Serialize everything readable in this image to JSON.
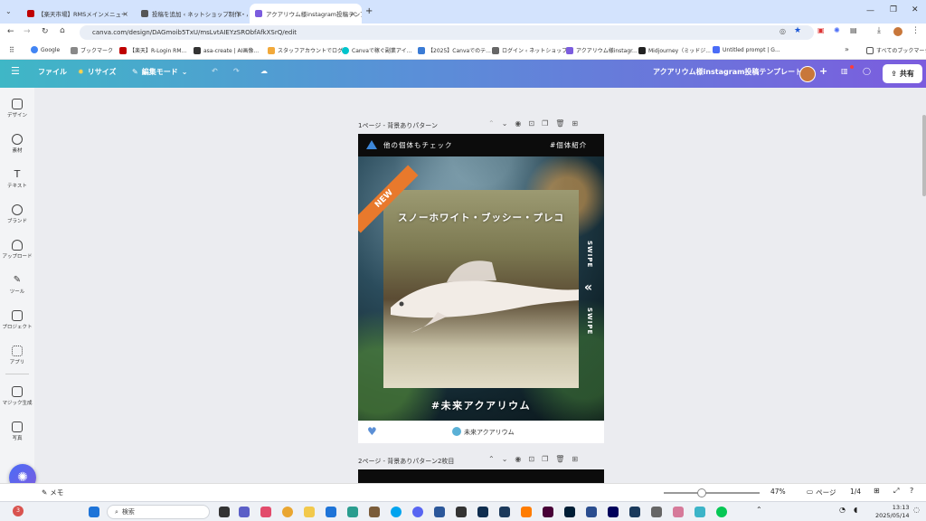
{
  "browser": {
    "tabs": [
      {
        "label": "【楽天市場】RMSメインメニュー"
      },
      {
        "label": "投稿を追加 ‹ ネットショップ制作・バ"
      },
      {
        "label": "アクアリウム様instagram投稿テンプ"
      }
    ],
    "url": "canva.com/design/DAGmoib5TxU/msLvtAIEYzSRObfAfkXSrQ/edit",
    "bookmarks": [
      "Google",
      "ブックマーク",
      "【楽天】R-Login RM...",
      "asa-create | AI画像...",
      "スタッフアカウントでログ...",
      "Canvaで稼ぐ副業アイ...",
      "【2025】Canvaでのテ...",
      "ログイン ‹ ネットショップ...",
      "アクアリウム様instagr...",
      "Midjourney（ミッドジ...",
      "Untitled prompt | G..."
    ],
    "all_bookmarks": "すべてのブックマーク"
  },
  "canva": {
    "menu_file": "ファイル",
    "resize": "リサイズ",
    "edit_mode": "編集モード",
    "doc_title": "アクアリウム様instagram投稿テンプレート",
    "share": "共有"
  },
  "sidebar": {
    "items": [
      {
        "label": "デザイン",
        "icon": "design-icon"
      },
      {
        "label": "素材",
        "icon": "elements-icon"
      },
      {
        "label": "テキスト",
        "icon": "text-icon"
      },
      {
        "label": "ブランド",
        "icon": "brand-icon"
      },
      {
        "label": "アップロード",
        "icon": "upload-icon"
      },
      {
        "label": "ツール",
        "icon": "tools-icon"
      },
      {
        "label": "プロジェクト",
        "icon": "folder-icon"
      },
      {
        "label": "アプリ",
        "icon": "apps-icon"
      },
      {
        "label": "マジック生成",
        "icon": "magic-icon"
      },
      {
        "label": "写真",
        "icon": "photo-icon"
      }
    ]
  },
  "pages": {
    "page1_label": "1ページ - 背景ありパターン",
    "page2_label": "2ページ - 背景ありパターン2枚目"
  },
  "design": {
    "top_left": "他の個体もチェック",
    "top_right": "#個体紹介",
    "badge": "NEW",
    "fish_name": "スノーホワイト・ブッシー・プレコ",
    "swipe": "SWIPE",
    "hashtag": "#未来アクアリウム",
    "logo_text": "未来アクアリウム"
  },
  "footer": {
    "memo": "メモ",
    "zoom": "47%",
    "page_btn": "ページ",
    "page_count": "1/4"
  },
  "taskbar": {
    "search": "検索",
    "time": "13:13",
    "date": "2025/05/14",
    "badge": "3"
  },
  "colors": {
    "accent": "#7b5cde",
    "badge_orange": "#e8792c"
  }
}
